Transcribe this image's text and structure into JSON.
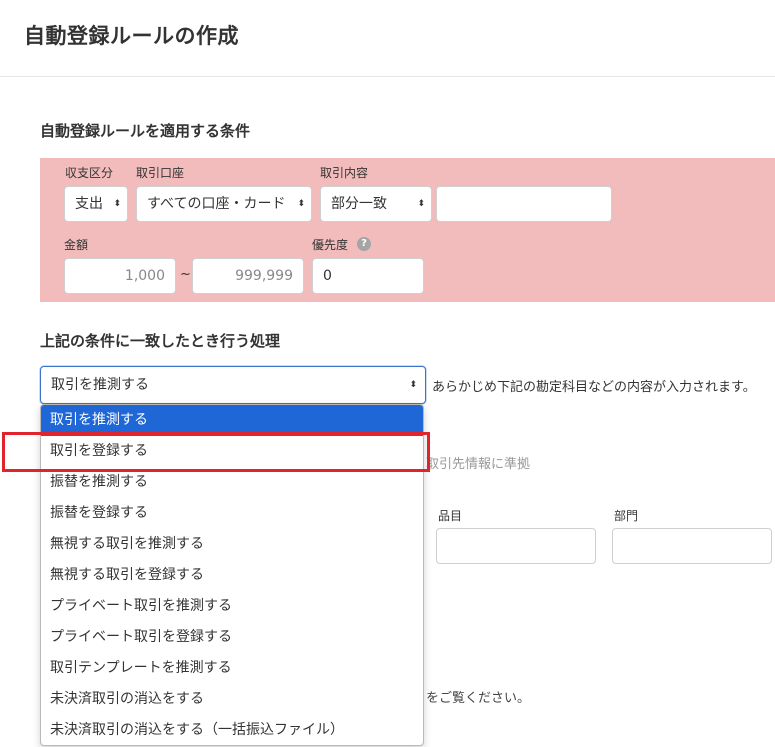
{
  "page_title": "自動登録ルールの作成",
  "conditions": {
    "section_title": "自動登録ルールを適用する条件",
    "income_expense": {
      "label": "収支区分",
      "value": "支出"
    },
    "account": {
      "label": "取引口座",
      "value": "すべての口座・カード"
    },
    "content": {
      "label": "取引内容",
      "match_value": "部分一致",
      "text_value": ""
    },
    "amount": {
      "label": "金額",
      "min_placeholder": "1,000",
      "tilde": "~",
      "max_placeholder": "999,999"
    },
    "priority": {
      "label": "優先度",
      "value": "0",
      "help": "?"
    },
    "panel_color": "#f2bcbc"
  },
  "action": {
    "section_title": "上記の条件に一致したとき行う処理",
    "selected_value": "取引を推測する",
    "hint": "あらかじめ下記の勘定科目などの内容が入力されます。",
    "options": [
      "取引を推測する",
      "取引を登録する",
      "振替を推測する",
      "振替を登録する",
      "無視する取引を推測する",
      "無視する取引を登録する",
      "プライベート取引を推測する",
      "プライベート取引を登録する",
      "取引テンプレートを推測する",
      "未決済取引の消込をする",
      "未決済取引の消込をする（一括振込ファイル）"
    ],
    "highlighted_option": "取引を登録する",
    "accent_color": "#1f66d6",
    "highlight_color": "#e1232b"
  },
  "background_fields": {
    "partner_note": "取引先情報に準拠",
    "item_label": "品目",
    "department_label": "部門",
    "see_note": "をご覧ください。"
  }
}
